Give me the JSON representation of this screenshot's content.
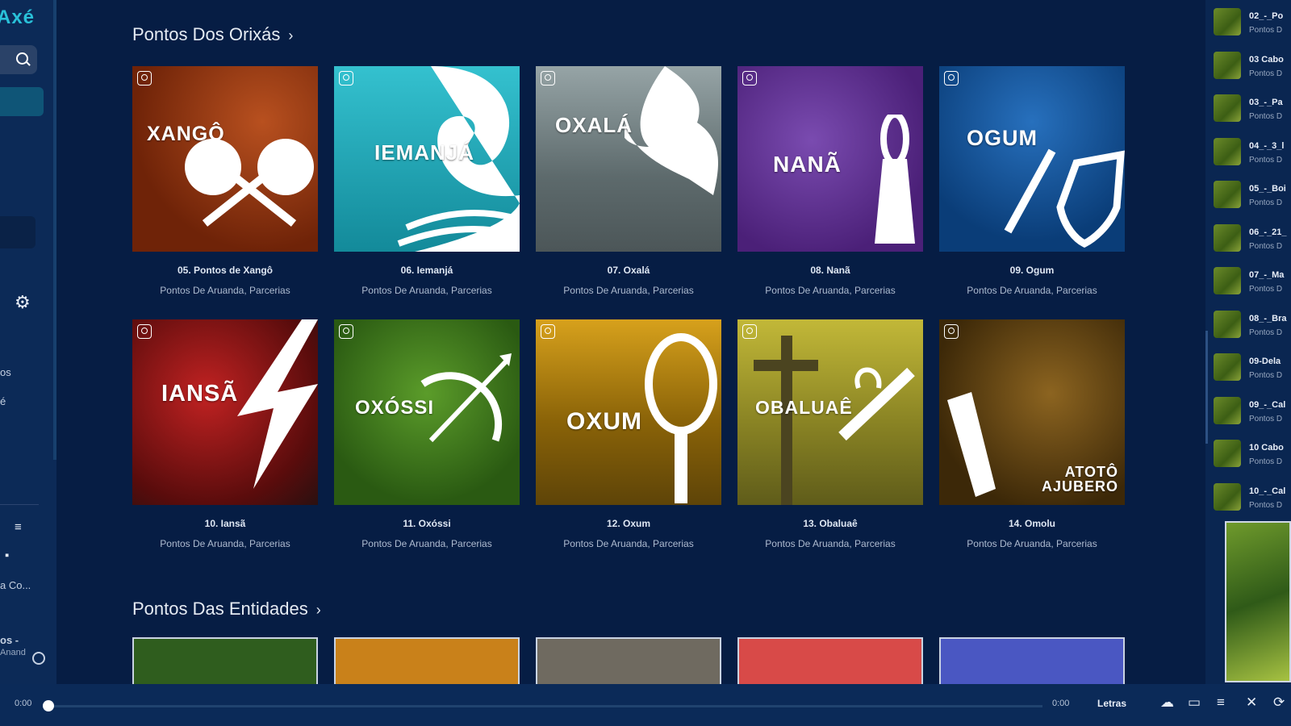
{
  "sidebar": {
    "brand": "Axé",
    "labels": [
      "os",
      "é",
      "a Co..."
    ],
    "bottom_title": "os -",
    "bottom_sub": "Anand"
  },
  "sections": [
    {
      "title": "Pontos Dos Orixás",
      "chevron": "›"
    },
    {
      "title": "Pontos Das Entidades",
      "chevron": "›"
    }
  ],
  "albums": [
    {
      "cover": "XANGÔ",
      "title": "05. Pontos de Xangô",
      "artist": "Pontos De Aruanda, Parcerias",
      "bg": "#8c2e10"
    },
    {
      "cover": "IEMANJÁ",
      "title": "06. Iemanjá",
      "artist": "Pontos De Aruanda, Parcerias",
      "bg": "#1aa3b2"
    },
    {
      "cover": "OXALÁ",
      "title": "07. Oxalá",
      "artist": "Pontos De Aruanda, Parcerias",
      "bg": "#6c7b80"
    },
    {
      "cover": "NANÃ",
      "title": "08. Nanã",
      "artist": "Pontos De Aruanda, Parcerias",
      "bg": "#5e2f90"
    },
    {
      "cover": "OGUM",
      "title": "09. Ogum",
      "artist": "Pontos De Aruanda, Parcerias",
      "bg": "#0d4f95"
    },
    {
      "cover": "IANSÃ",
      "title": "10. Iansã",
      "artist": "Pontos De Aruanda, Parcerias",
      "bg": "#8e1717"
    },
    {
      "cover": "OXÓSSI",
      "title": "11. Oxóssi",
      "artist": "Pontos De Aruanda, Parcerias",
      "bg": "#3d7a1a"
    },
    {
      "cover": "OXUM",
      "title": "12. Oxum",
      "artist": "Pontos De Aruanda, Parcerias",
      "bg": "#b08410"
    },
    {
      "cover": "OBALUAÊ",
      "title": "13. Obaluaê",
      "artist": "Pontos De Aruanda, Parcerias",
      "bg": "#8a8428"
    },
    {
      "cover": "ATOTÔ AJUBERO",
      "title": "14. Omolu",
      "artist": "Pontos De Aruanda, Parcerias",
      "bg": "#4e3510"
    }
  ],
  "bottom_row_colors": [
    "#2f5d1e",
    "#c9811a",
    "#6f6a60",
    "#d84a48",
    "#4a57c2"
  ],
  "queue": [
    {
      "name": "02_-_Po",
      "artist": "Pontos D"
    },
    {
      "name": "03 Cabo",
      "artist": "Pontos D"
    },
    {
      "name": "03_-_Pa",
      "artist": "Pontos D"
    },
    {
      "name": "04_-_3_l",
      "artist": "Pontos D"
    },
    {
      "name": "05_-_Boi",
      "artist": "Pontos D"
    },
    {
      "name": "06_-_21_",
      "artist": "Pontos D"
    },
    {
      "name": "07_-_Ma",
      "artist": "Pontos D"
    },
    {
      "name": "08_-_Bra",
      "artist": "Pontos D"
    },
    {
      "name": "09-Dela",
      "artist": "Pontos D"
    },
    {
      "name": "09_-_Cal",
      "artist": "Pontos D"
    },
    {
      "name": "10 Cabo",
      "artist": "Pontos D"
    },
    {
      "name": "10_-_Cal",
      "artist": "Pontos D"
    }
  ],
  "player": {
    "time_current": "0:00",
    "time_total": "0:00",
    "progress": 0,
    "lyrics": "Letras"
  }
}
